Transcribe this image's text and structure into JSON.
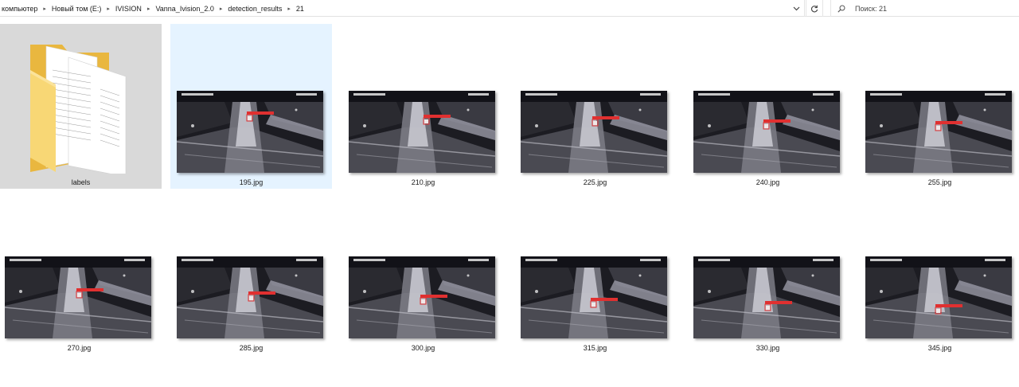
{
  "breadcrumb": [
    "компьютер",
    "Новый том (E:)",
    "IVISION",
    "Vanna_Ivision_2.0",
    "detection_results",
    "21"
  ],
  "search": {
    "placeholder": "Поиск: 21"
  },
  "items": [
    {
      "name": "labels",
      "type": "folder"
    },
    {
      "name": "195.jpg",
      "type": "image",
      "selected": true
    },
    {
      "name": "210.jpg",
      "type": "image"
    },
    {
      "name": "225.jpg",
      "type": "image"
    },
    {
      "name": "240.jpg",
      "type": "image"
    },
    {
      "name": "255.jpg",
      "type": "image"
    },
    {
      "name": "270.jpg",
      "type": "image"
    },
    {
      "name": "285.jpg",
      "type": "image"
    },
    {
      "name": "300.jpg",
      "type": "image"
    },
    {
      "name": "315.jpg",
      "type": "image"
    },
    {
      "name": "330.jpg",
      "type": "image"
    },
    {
      "name": "345.jpg",
      "type": "image"
    }
  ],
  "colors": {
    "selection": "#e5f3ff",
    "folder_bg": "#d9d9d9",
    "folder": "#f8d775",
    "detection_box": "#e03030"
  },
  "icons": {
    "dropdown": "chevron-down-icon",
    "refresh": "refresh-icon",
    "search": "search-icon"
  }
}
